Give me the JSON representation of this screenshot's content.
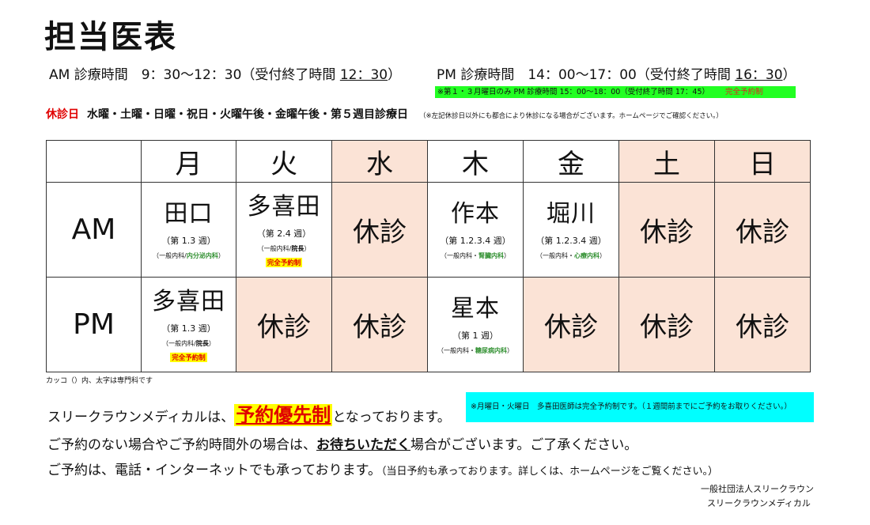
{
  "title": "担当医表",
  "hours": {
    "am_prefix": "AM 診療時間　9：30〜12：30（受付終了時間 ",
    "am_end": "12：30",
    "am_suffix": "）",
    "pm_prefix": "PM 診療時間　14：00〜17：00（受付終了時間 ",
    "pm_end": "16：30",
    "pm_suffix": "）",
    "pm_note": "※第１・３月曜日のみ PM 診療時間 15：00〜18：00（受付終了時間 17：45）",
    "pm_note_red": "完全予約制"
  },
  "holiday": {
    "label": "休診日",
    "days": "水曜・土曜・日曜・祝日・火曜午後・金曜午後・第５週目診療日",
    "note": "（※左記休診日以外にも都合により休診になる場合がございます。ホームページでご確認ください。）"
  },
  "schedule": {
    "days": [
      "月",
      "火",
      "水",
      "木",
      "金",
      "土",
      "日"
    ],
    "am_label": "AM",
    "pm_label": "PM",
    "closed": "休診",
    "am": {
      "mon": {
        "doctor": "田口",
        "weeks": "（第 1.3 週）",
        "dept_prefix": "（一般内科/",
        "dept_bold": "内分泌内科",
        "dept_suffix": "）"
      },
      "tue": {
        "doctor": "多喜田",
        "weeks": "（第 2.4 週）",
        "dept_prefix": "（一般内科/",
        "dept_bold": "院長",
        "dept_suffix": "）",
        "badge": "完全予約制"
      },
      "thu": {
        "doctor": "作本",
        "weeks": "（第 1.2.3.4 週）",
        "dept_prefix": "（一般内科・",
        "dept_bold": "腎臓内科",
        "dept_suffix": "）"
      },
      "fri": {
        "doctor": "堀川",
        "weeks": "（第 1.2.3.4 週）",
        "dept_prefix": "（一般内科・",
        "dept_bold": "心療内科",
        "dept_suffix": "）"
      }
    },
    "pm": {
      "mon": {
        "doctor": "多喜田",
        "weeks": "（第 1.3 週）",
        "dept_prefix": "（一般内科/",
        "dept_bold": "院長",
        "dept_suffix": "）",
        "badge": "完全予約制"
      },
      "thu": {
        "doctor": "星本",
        "weeks": "（第 1 週）",
        "dept_prefix": "（一般内科・",
        "dept_bold": "糖尿病内科",
        "dept_suffix": "）"
      }
    }
  },
  "colors": {
    "closed_bg": "#fbe3d6",
    "specialty": "#2f8f2f",
    "alert": "#e00000",
    "highlight_yellow": "#ffff00",
    "note_green": "#22ff22",
    "note_cyan": "#00ffff"
  },
  "footnote": "カッコ（）内、太字は専門科です",
  "notice": {
    "line1_prefix": "スリークラウンメディカルは、",
    "line1_priority": "予約優先制",
    "line1_suffix": "となっております。",
    "cyan_note": "※月曜日・火曜日　多喜田医師は完全予約制です。（１週間前までにご予約をお取りください。）",
    "line2_prefix": "ご予約のない場合やご予約時間外の場合は、",
    "line2_emph": "お待ちいただく",
    "line2_suffix": "場合がございます。ご了承ください。",
    "line3_main": "ご予約は、電話・インターネットでも承っております。",
    "line3_small": "（当日予約も承っております。詳しくは、ホームページをご覧ください。）"
  },
  "org": {
    "line1": "一般社団法人スリークラウン",
    "line2": "スリークラウンメディカル"
  }
}
